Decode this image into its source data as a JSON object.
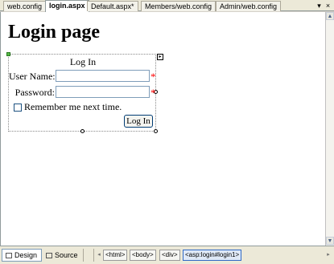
{
  "tabs": [
    {
      "label": "web.config",
      "active": false
    },
    {
      "label": "login.aspx",
      "active": true
    },
    {
      "label": "Default.aspx*",
      "active": false
    },
    {
      "label": "Members/web.config",
      "active": false
    },
    {
      "label": "Admin/web.config",
      "active": false
    }
  ],
  "tab_controls": {
    "dropdown": "▾",
    "close": "×"
  },
  "page": {
    "title": "Login page"
  },
  "login": {
    "title": "Log In",
    "username_label": "User Name:",
    "password_label": "Password:",
    "required_marker": "*",
    "remember_label": "Remember me next time.",
    "button_label": "Log In"
  },
  "scrollbar": {
    "up": "▲",
    "down": "▼"
  },
  "bottom": {
    "views": [
      {
        "label": "Design",
        "active": true,
        "icon": "design-view-icon"
      },
      {
        "label": "Source",
        "active": false,
        "icon": "source-view-icon"
      }
    ],
    "nav_prev": "◂",
    "nav_next": "▸",
    "breadcrumbs": [
      {
        "label": "<html>",
        "selected": false
      },
      {
        "label": "<body>",
        "selected": false
      },
      {
        "label": "<div>",
        "selected": false
      },
      {
        "label": "<asp:login#login1>",
        "selected": true
      }
    ]
  },
  "colors": {
    "required": "#ff0000",
    "selected_handle": "#57b947",
    "chrome": "#ece9d8"
  }
}
